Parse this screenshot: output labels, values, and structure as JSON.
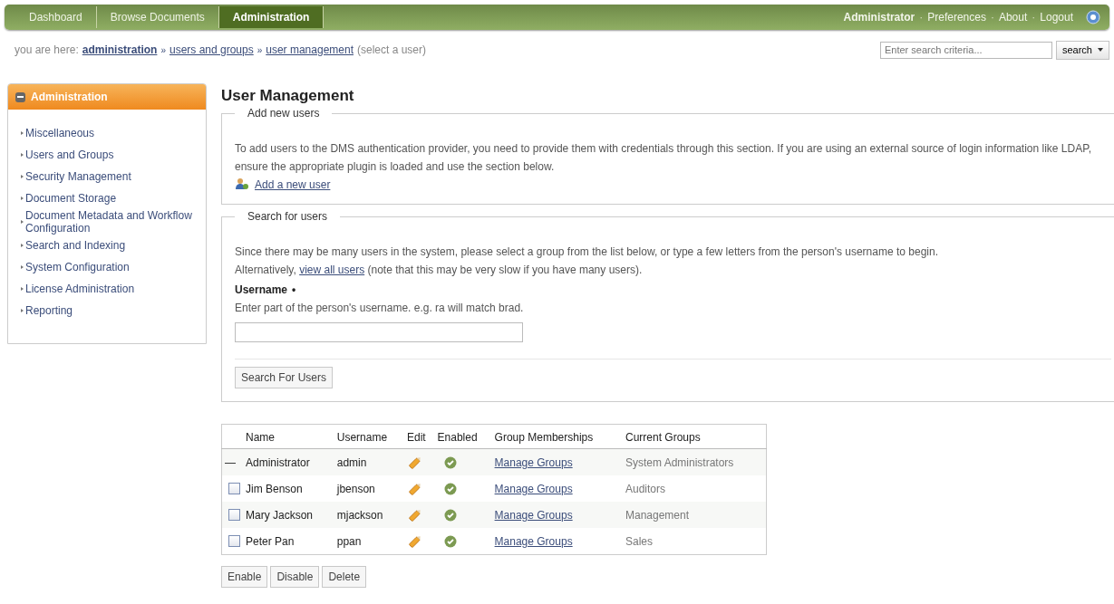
{
  "nav": {
    "tabs": [
      {
        "label": "Dashboard",
        "selected": false
      },
      {
        "label": "Browse Documents",
        "selected": false
      },
      {
        "label": "Administration",
        "selected": true
      }
    ],
    "user": "Administrator",
    "separator": "·",
    "links": [
      "Preferences",
      "About",
      "Logout"
    ]
  },
  "breadcrumb": {
    "prefix": "you are here:",
    "separator": "»",
    "links": [
      {
        "label": "administration",
        "bold": true
      },
      {
        "label": "users and groups",
        "bold": false
      },
      {
        "label": "user management",
        "bold": false
      }
    ],
    "note": "(select a user)"
  },
  "search": {
    "placeholder": "Enter search criteria...",
    "button": "search"
  },
  "sidebar": {
    "title": "Administration",
    "expanded": true,
    "items": [
      "Miscellaneous",
      "Users and Groups",
      "Security Management",
      "Document Storage",
      "Document Metadata and Workflow Configuration",
      "Search and Indexing",
      "System Configuration",
      "License Administration",
      "Reporting"
    ]
  },
  "page_title": "User Management",
  "add_users": {
    "legend": "Add new users",
    "text": "To add users to the DMS authentication provider, you need to provide them with credentials through this section. If you are using an external source of login information like LDAP, ensure the appropriate plugin is loaded and use the section below.",
    "link": "Add a new user"
  },
  "search_users": {
    "legend": "Search for users",
    "text": "Since there may be many users in the system, please select a group from the list below, or type a few letters from the person's username to begin.",
    "alt_before": "Alternatively,",
    "alt_link": "view all users",
    "alt_after": "(note that this may be very slow if you have many users).",
    "field_label": "Username",
    "required_mark": "•",
    "hint": "Enter part of the person's username. e.g. ra will match brad.",
    "button": "Search For Users"
  },
  "table": {
    "columns": [
      "Name",
      "Username",
      "Edit",
      "Enabled",
      "Group Memberships",
      "Current Groups"
    ],
    "rows": [
      {
        "kind": "dash",
        "mark": "—",
        "name": "Administrator",
        "username": "admin",
        "enabled": true,
        "link": "Manage Groups",
        "groups": "System Administrators"
      },
      {
        "kind": "checkbox",
        "checked": false,
        "name": "Jim Benson",
        "username": "jbenson",
        "enabled": true,
        "link": "Manage Groups",
        "groups": "Auditors"
      },
      {
        "kind": "checkbox",
        "checked": false,
        "name": "Mary Jackson",
        "username": "mjackson",
        "enabled": true,
        "link": "Manage Groups",
        "groups": "Management"
      },
      {
        "kind": "checkbox",
        "checked": false,
        "name": "Peter Pan",
        "username": "ppan",
        "enabled": true,
        "link": "Manage Groups",
        "groups": "Sales"
      }
    ]
  },
  "actions": [
    "Enable",
    "Disable",
    "Delete"
  ]
}
